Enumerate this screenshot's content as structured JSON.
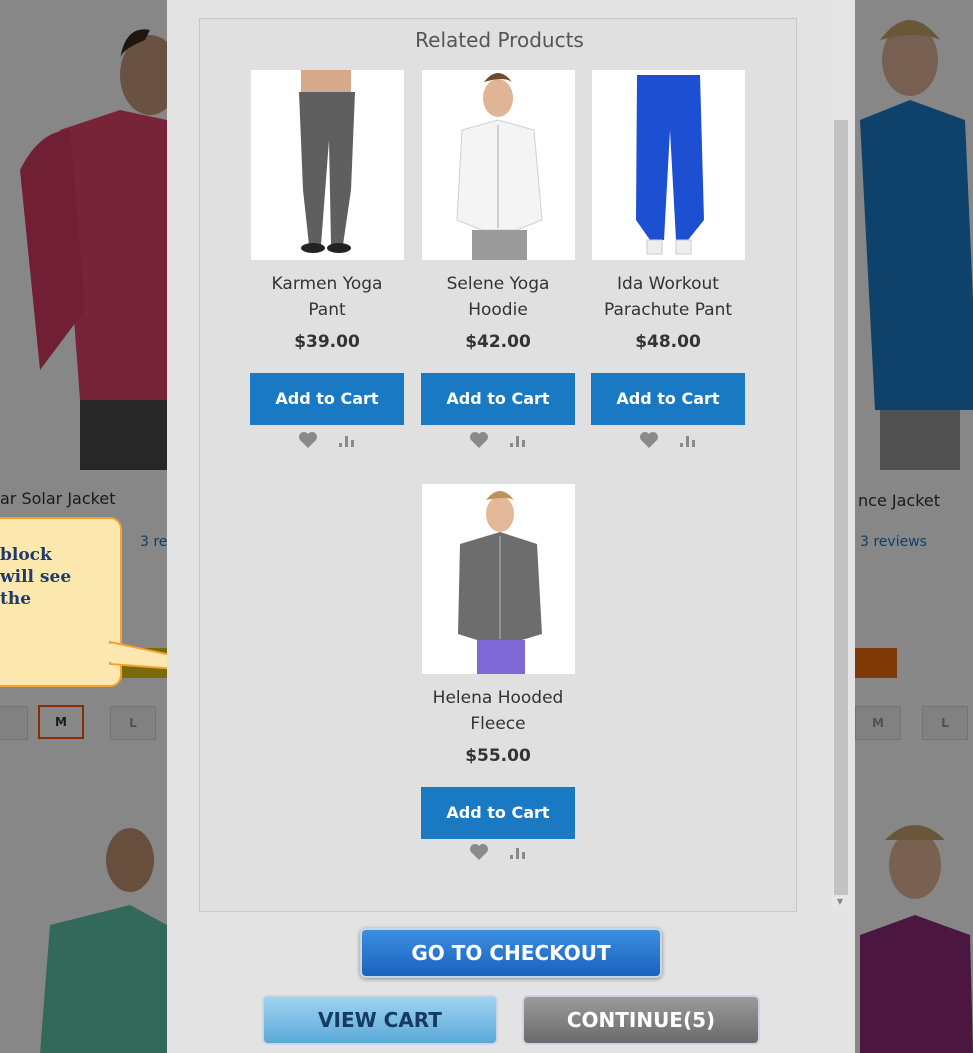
{
  "background": {
    "left_product_name": "ar Solar Jacket",
    "left_reviews": "3 revie",
    "right_product_name": "nce Jacket",
    "right_reviews": "3 reviews",
    "sizes_left": [
      "",
      "M",
      "L"
    ],
    "sizes_right": [
      "M",
      "L"
    ],
    "selected_size": "M"
  },
  "callout": {
    "line1": "block",
    "line2": "will see",
    "line3": "the"
  },
  "modal": {
    "related_title": "Related Products",
    "products": [
      {
        "name_line1": "Karmen Yoga",
        "name_line2": "Pant",
        "price": "$39.00",
        "cart_label": "Add to Cart"
      },
      {
        "name_line1": "Selene Yoga",
        "name_line2": "Hoodie",
        "price": "$42.00",
        "cart_label": "Add to Cart"
      },
      {
        "name_line1": "Ida Workout",
        "name_line2": "Parachute Pant",
        "price": "$48.00",
        "cart_label": "Add to Cart"
      },
      {
        "name_line1": "Helena Hooded",
        "name_line2": "Fleece",
        "price": "$55.00",
        "cart_label": "Add to Cart"
      }
    ],
    "checkout_label": "GO TO CHECKOUT",
    "view_cart_label": "VIEW CART",
    "continue_label": "CONTINUE(5)"
  },
  "colors": {
    "accent": "#1979c3",
    "callout_fill": "#fde9b0",
    "callout_border": "#f7a033",
    "selected_size_border": "#ff5501"
  }
}
